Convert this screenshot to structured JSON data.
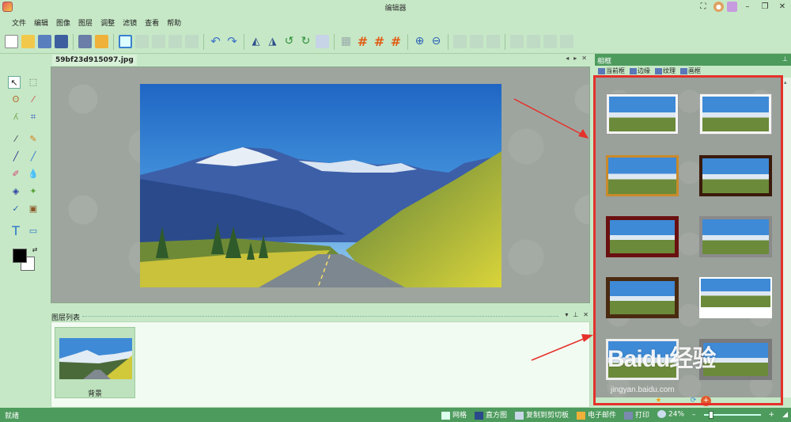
{
  "window": {
    "title": "编辑器"
  },
  "menu": {
    "items": [
      "文件",
      "编辑",
      "图像",
      "图层",
      "调整",
      "滤镜",
      "查看",
      "帮助"
    ]
  },
  "toolbar": {
    "icons": [
      "new-icon",
      "open-icon",
      "save-icon",
      "save-as-icon",
      "print-icon",
      "email-icon",
      "frame-icon",
      "cut-icon",
      "copy-icon",
      "paste-icon",
      "clear-icon",
      "undo-icon",
      "redo-icon",
      "flip-horizontal-icon",
      "flip-vertical-icon",
      "rotate-left-icon",
      "rotate-right-icon",
      "resize-icon",
      "grid-icon",
      "hash-icon",
      "crop-grid-icon",
      "zoom-in-icon",
      "zoom-out-icon"
    ]
  },
  "document": {
    "tab_label": "59bf23d915097.jpg"
  },
  "layers": {
    "title": "图层列表",
    "items": [
      {
        "name": "背景"
      }
    ]
  },
  "frame_panel": {
    "title": "相框",
    "tabs": [
      "当前框",
      "边缘",
      "纹理",
      "画框"
    ]
  },
  "statusbar": {
    "status": "就绪",
    "grid": "网格",
    "histogram": "直方图",
    "copy_clipboard": "复制到剪切板",
    "email": "电子邮件",
    "print": "打印",
    "zoom": "24%"
  },
  "watermark": {
    "main": "Baidu经验",
    "sub": "jingyan.baidu.com"
  },
  "colors": {
    "app_bg": "#c6e8c6",
    "statusbar_bg": "#4d9b5d",
    "highlight": "#e5312b",
    "foreground_color": "#000000",
    "background_color": "#ffffff"
  }
}
